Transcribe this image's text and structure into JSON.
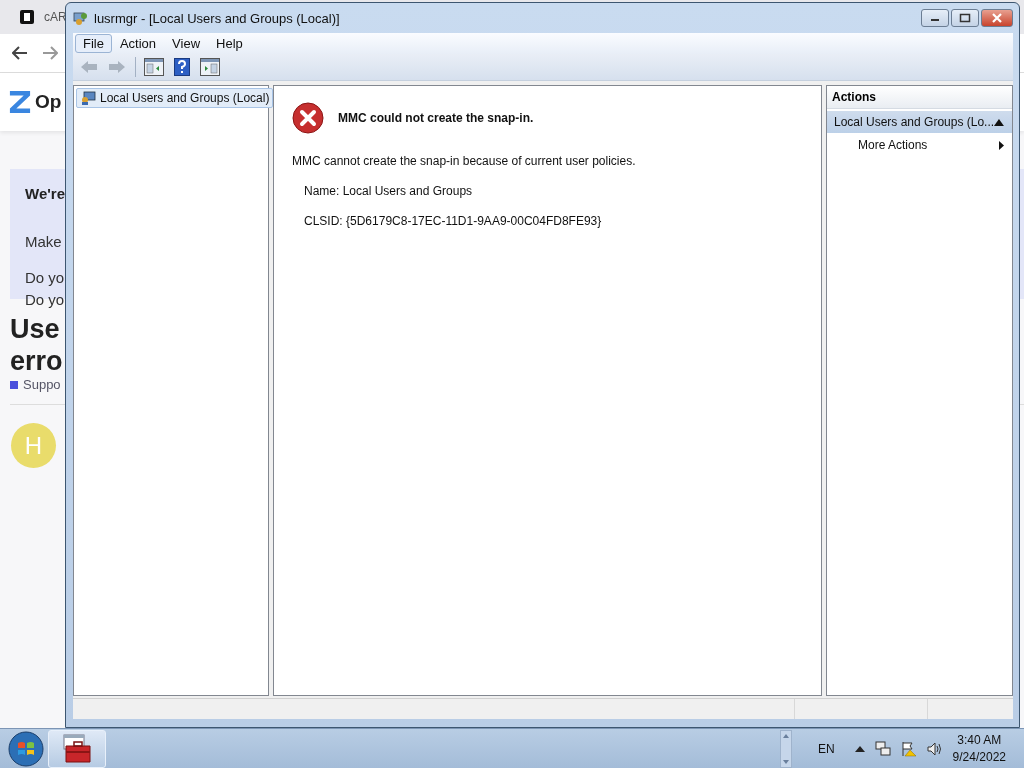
{
  "background_browser": {
    "tab_title": "cAR",
    "logo_text": "Op",
    "notice": {
      "title": "We're",
      "lines": [
        "Make",
        "Do yo",
        "Do yo"
      ]
    },
    "heading_lines": [
      "Use",
      "erro"
    ],
    "tag": "Suppo",
    "avatar_initial": "H"
  },
  "window": {
    "title": "lusrmgr - [Local Users and Groups (Local)]",
    "menu": [
      {
        "label": "File",
        "selected": true
      },
      {
        "label": "Action",
        "selected": false
      },
      {
        "label": "View",
        "selected": false
      },
      {
        "label": "Help",
        "selected": false
      }
    ],
    "toolbar": [
      {
        "kind": "back",
        "disabled": true
      },
      {
        "kind": "forward",
        "disabled": true
      },
      {
        "kind": "separator"
      },
      {
        "kind": "tree-toggle"
      },
      {
        "kind": "help"
      },
      {
        "kind": "action-toggle"
      }
    ],
    "tree": [
      {
        "label": "Local Users and Groups (Local)",
        "selected": true
      }
    ],
    "error": {
      "title": "MMC could not create the snap-in.",
      "message": "MMC cannot create the snap-in because of current user policies.",
      "details": [
        "Name: Local Users and Groups",
        "CLSID: {5D6179C8-17EC-11D1-9AA9-00C04FD8FE93}"
      ]
    },
    "actions": {
      "header": "Actions",
      "sections": [
        {
          "label": "Local Users and Groups (Lo...",
          "expanded": true,
          "items": [
            {
              "label": "More Actions"
            }
          ]
        }
      ]
    }
  },
  "taskbar": {
    "language": "EN",
    "time": "3:40 AM",
    "date": "9/24/2022"
  }
}
